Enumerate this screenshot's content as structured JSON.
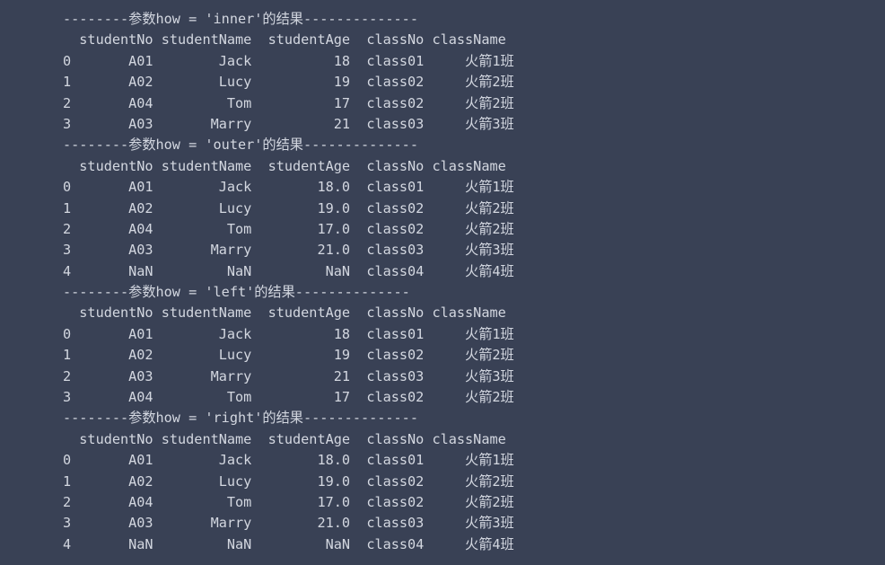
{
  "console": {
    "background_color": "#394155",
    "text_color": "#d3d7e0",
    "separator_prefix": "--------",
    "separator_suffix": "--------------",
    "separator_label_prefix": "参数how = ",
    "separator_label_suffix": "的结果",
    "column_headers": [
      "studentNo",
      "studentName",
      "studentAge",
      "classNo",
      "className"
    ],
    "index_header": ""
  },
  "blocks": [
    {
      "how": "'inner'",
      "title": "--------参数how = 'inner'的结果--------------",
      "header": "  studentNo studentName  studentAge  classNo className",
      "rows": [
        "0       A01        Jack          18  class01     火箭1班",
        "1       A02        Lucy          19  class02     火箭2班",
        "2       A04         Tom          17  class02     火箭2班",
        "3       A03       Marry          21  class03     火箭3班"
      ],
      "records": [
        {
          "index": "0",
          "studentNo": "A01",
          "studentName": "Jack",
          "studentAge": "18",
          "classNo": "class01",
          "className": "火箭1班"
        },
        {
          "index": "1",
          "studentNo": "A02",
          "studentName": "Lucy",
          "studentAge": "19",
          "classNo": "class02",
          "className": "火箭2班"
        },
        {
          "index": "2",
          "studentNo": "A04",
          "studentName": "Tom",
          "studentAge": "17",
          "classNo": "class02",
          "className": "火箭2班"
        },
        {
          "index": "3",
          "studentNo": "A03",
          "studentName": "Marry",
          "studentAge": "21",
          "classNo": "class03",
          "className": "火箭3班"
        }
      ]
    },
    {
      "how": "'outer'",
      "title": "--------参数how = 'outer'的结果--------------",
      "header": "  studentNo studentName  studentAge  classNo className",
      "rows": [
        "0       A01        Jack        18.0  class01     火箭1班",
        "1       A02        Lucy        19.0  class02     火箭2班",
        "2       A04         Tom        17.0  class02     火箭2班",
        "3       A03       Marry        21.0  class03     火箭3班",
        "4       NaN         NaN         NaN  class04     火箭4班"
      ],
      "records": [
        {
          "index": "0",
          "studentNo": "A01",
          "studentName": "Jack",
          "studentAge": "18.0",
          "classNo": "class01",
          "className": "火箭1班"
        },
        {
          "index": "1",
          "studentNo": "A02",
          "studentName": "Lucy",
          "studentAge": "19.0",
          "classNo": "class02",
          "className": "火箭2班"
        },
        {
          "index": "2",
          "studentNo": "A04",
          "studentName": "Tom",
          "studentAge": "17.0",
          "classNo": "class02",
          "className": "火箭2班"
        },
        {
          "index": "3",
          "studentNo": "A03",
          "studentName": "Marry",
          "studentAge": "21.0",
          "classNo": "class03",
          "className": "火箭3班"
        },
        {
          "index": "4",
          "studentNo": "NaN",
          "studentName": "NaN",
          "studentAge": "NaN",
          "classNo": "class04",
          "className": "火箭4班"
        }
      ]
    },
    {
      "how": "'left'",
      "title": "--------参数how = 'left'的结果--------------",
      "header": "  studentNo studentName  studentAge  classNo className",
      "rows": [
        "0       A01        Jack          18  class01     火箭1班",
        "1       A02        Lucy          19  class02     火箭2班",
        "2       A03       Marry          21  class03     火箭3班",
        "3       A04         Tom          17  class02     火箭2班"
      ],
      "records": [
        {
          "index": "0",
          "studentNo": "A01",
          "studentName": "Jack",
          "studentAge": "18",
          "classNo": "class01",
          "className": "火箭1班"
        },
        {
          "index": "1",
          "studentNo": "A02",
          "studentName": "Lucy",
          "studentAge": "19",
          "classNo": "class02",
          "className": "火箭2班"
        },
        {
          "index": "2",
          "studentNo": "A03",
          "studentName": "Marry",
          "studentAge": "21",
          "classNo": "class03",
          "className": "火箭3班"
        },
        {
          "index": "3",
          "studentNo": "A04",
          "studentName": "Tom",
          "studentAge": "17",
          "classNo": "class02",
          "className": "火箭2班"
        }
      ]
    },
    {
      "how": "'right'",
      "title": "--------参数how = 'right'的结果--------------",
      "header": "  studentNo studentName  studentAge  classNo className",
      "rows": [
        "0       A01        Jack        18.0  class01     火箭1班",
        "1       A02        Lucy        19.0  class02     火箭2班",
        "2       A04         Tom        17.0  class02     火箭2班",
        "3       A03       Marry        21.0  class03     火箭3班",
        "4       NaN         NaN         NaN  class04     火箭4班"
      ],
      "records": [
        {
          "index": "0",
          "studentNo": "A01",
          "studentName": "Jack",
          "studentAge": "18.0",
          "classNo": "class01",
          "className": "火箭1班"
        },
        {
          "index": "1",
          "studentNo": "A02",
          "studentName": "Lucy",
          "studentAge": "19.0",
          "classNo": "class02",
          "className": "火箭2班"
        },
        {
          "index": "2",
          "studentNo": "A04",
          "studentName": "Tom",
          "studentAge": "17.0",
          "classNo": "class02",
          "className": "火箭2班"
        },
        {
          "index": "3",
          "studentNo": "A03",
          "studentName": "Marry",
          "studentAge": "21.0",
          "classNo": "class03",
          "className": "火箭3班"
        },
        {
          "index": "4",
          "studentNo": "NaN",
          "studentName": "NaN",
          "studentAge": "NaN",
          "classNo": "class04",
          "className": "火箭4班"
        }
      ]
    }
  ]
}
